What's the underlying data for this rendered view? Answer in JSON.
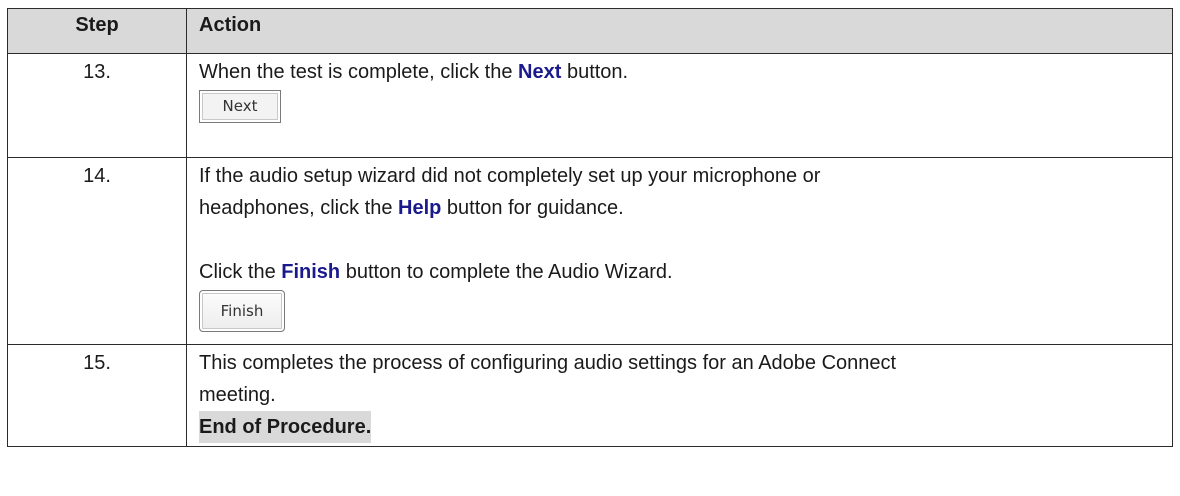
{
  "table": {
    "headers": {
      "step": "Step",
      "action": "Action"
    },
    "rows": [
      {
        "step": "13.",
        "text_before": "When the test is complete, click the ",
        "keyword": "Next",
        "text_after": " button.",
        "button_label": "Next"
      },
      {
        "step": "14.",
        "line1": "If the audio setup wizard did not completely set up your microphone or",
        "line2_before": "headphones, click the ",
        "line2_keyword": "Help",
        "line2_after": " button for guidance.",
        "line3_before": "Click the ",
        "line3_keyword": "Finish",
        "line3_after": " button to complete the Audio Wizard.",
        "button_label": "Finish"
      },
      {
        "step": "15.",
        "line1": "This completes the process of configuring audio settings for an Adobe Connect",
        "line2": "meeting.",
        "end_label": "End of Procedure."
      }
    ]
  }
}
